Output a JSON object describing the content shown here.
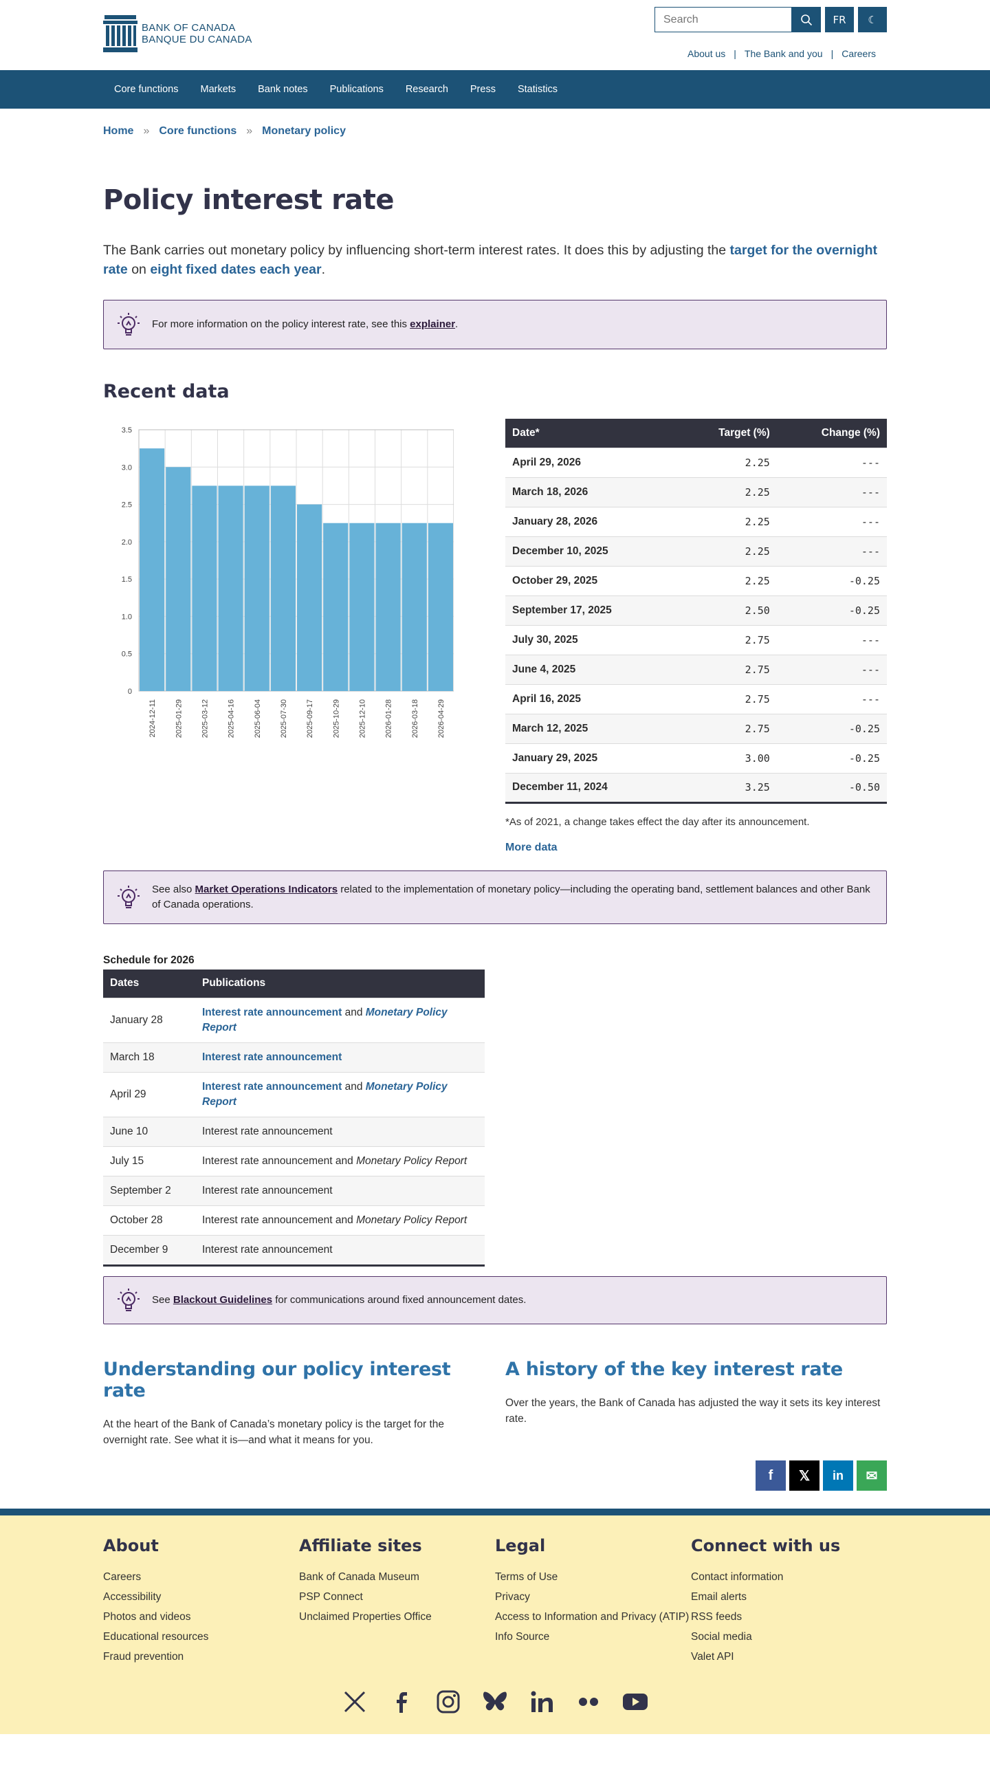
{
  "header": {
    "logo_line1": "BANK OF CANADA",
    "logo_line2": "BANQUE DU CANADA",
    "search_placeholder": "Search",
    "lang_label": "FR",
    "toplinks": [
      "About us",
      "The Bank and you",
      "Careers"
    ]
  },
  "nav": [
    "Core functions",
    "Markets",
    "Bank notes",
    "Publications",
    "Research",
    "Press",
    "Statistics"
  ],
  "breadcrumb": [
    "Home",
    "Core functions",
    "Monetary policy"
  ],
  "page_title": "Policy interest rate",
  "lead": {
    "text1": "The Bank carries out monetary policy by influencing short-term interest rates. It does this by adjusting the ",
    "link1": "target for the overnight rate",
    "text2": " on ",
    "link2": "eight fixed dates each year",
    "text3": "."
  },
  "callout1": {
    "text": "For more information on the policy interest rate, see this ",
    "link": "explainer",
    "after": "."
  },
  "recent_title": "Recent data",
  "chart_data": {
    "type": "bar",
    "categories": [
      "2024-12-11",
      "2025-01-29",
      "2025-03-12",
      "2025-04-16",
      "2025-06-04",
      "2025-07-30",
      "2025-09-17",
      "2025-10-29",
      "2025-12-10",
      "2026-01-28",
      "2026-03-18",
      "2026-04-29"
    ],
    "values": [
      3.25,
      3.0,
      2.75,
      2.75,
      2.75,
      2.75,
      2.5,
      2.25,
      2.25,
      2.25,
      2.25,
      2.25
    ],
    "yticks": [
      "0",
      "0.5",
      "1.0",
      "1.5",
      "2.0",
      "2.5",
      "3.0",
      "3.5"
    ],
    "ylim": [
      0,
      3.5
    ],
    "bar_color": "#67b2d8",
    "grid": true
  },
  "rate_table": {
    "headers": [
      "Date*",
      "Target (%)",
      "Change (%)"
    ],
    "rows": [
      [
        "April 29, 2026",
        "2.25",
        "---"
      ],
      [
        "March 18, 2026",
        "2.25",
        "---"
      ],
      [
        "January 28, 2026",
        "2.25",
        "---"
      ],
      [
        "December 10, 2025",
        "2.25",
        "---"
      ],
      [
        "October 29, 2025",
        "2.25",
        "-0.25"
      ],
      [
        "September 17, 2025",
        "2.50",
        "-0.25"
      ],
      [
        "July 30, 2025",
        "2.75",
        "---"
      ],
      [
        "June 4, 2025",
        "2.75",
        "---"
      ],
      [
        "April 16, 2025",
        "2.75",
        "---"
      ],
      [
        "March 12, 2025",
        "2.75",
        "-0.25"
      ],
      [
        "January 29, 2025",
        "3.00",
        "-0.25"
      ],
      [
        "December 11, 2024",
        "3.25",
        "-0.50"
      ]
    ],
    "footnote": "*As of 2021, a change takes effect the day after its announcement.",
    "more_link": "More data"
  },
  "callout2": {
    "text": "See also ",
    "link": "Market Operations Indicators",
    "after": " related to the implementation of monetary policy—including the operating band, settlement balances and other Bank of Canada operations."
  },
  "schedule": {
    "title": "Schedule for 2026",
    "headers": [
      "Dates",
      "Publications"
    ],
    "rows": [
      {
        "date": "January 28",
        "pub": "Interest rate announcement",
        "mpr": "Monetary Policy Report",
        "linked": true
      },
      {
        "date": "March 18",
        "pub": "Interest rate announcement",
        "mpr": "",
        "linked": true
      },
      {
        "date": "April 29",
        "pub": "Interest rate announcement",
        "mpr": "Monetary Policy Report",
        "linked": true
      },
      {
        "date": "June 10",
        "pub": "Interest rate announcement",
        "mpr": "",
        "linked": false
      },
      {
        "date": "July 15",
        "pub": "Interest rate announcement",
        "mpr": "Monetary Policy Report",
        "linked": false
      },
      {
        "date": "September 2",
        "pub": "Interest rate announcement",
        "mpr": "",
        "linked": false
      },
      {
        "date": "October 28",
        "pub": "Interest rate announcement",
        "mpr": "Monetary Policy Report",
        "linked": false
      },
      {
        "date": "December 9",
        "pub": "Interest rate announcement",
        "mpr": "",
        "linked": false
      }
    ],
    "and_word": " and "
  },
  "callout3": {
    "text": "See ",
    "link": "Blackout Guidelines",
    "after": " for communications around fixed announcement dates."
  },
  "understanding": {
    "title": "Understanding our policy interest rate",
    "text": "At the heart of the Bank of Canada’s monetary policy is the target for the overnight rate. See what it is—and what it means for you."
  },
  "history": {
    "title": "A history of the key interest rate",
    "text": "Over the years, the Bank of Canada has adjusted the way it sets its key interest rate."
  },
  "share_icons": [
    "facebook-icon",
    "x-icon",
    "linkedin-icon",
    "email-icon"
  ],
  "colors": {
    "brand": "#1c5276",
    "accent_link": "#2a6496",
    "callout_bg": "#ece5f0",
    "footer_bg": "#fcf0b8"
  },
  "footer": {
    "about": {
      "title": "About",
      "links": [
        "Careers",
        "Accessibility",
        "Photos and videos",
        "Educational resources",
        "Fraud prevention"
      ]
    },
    "affiliate": {
      "title": "Affiliate sites",
      "links": [
        "Bank of Canada Museum",
        "PSP Connect",
        "Unclaimed Properties Office"
      ]
    },
    "legal": {
      "title": "Legal",
      "links": [
        "Terms of Use",
        "Privacy",
        "Access to Information and Privacy (ATIP)",
        "Info Source"
      ]
    },
    "connect": {
      "title": "Connect with us",
      "links": [
        "Contact information",
        "Email alerts",
        "RSS feeds",
        "Social media",
        "Valet API"
      ]
    },
    "social": [
      "x-icon",
      "facebook-icon",
      "instagram-icon",
      "bluesky-icon",
      "linkedin-icon",
      "flickr-icon",
      "youtube-icon"
    ]
  }
}
